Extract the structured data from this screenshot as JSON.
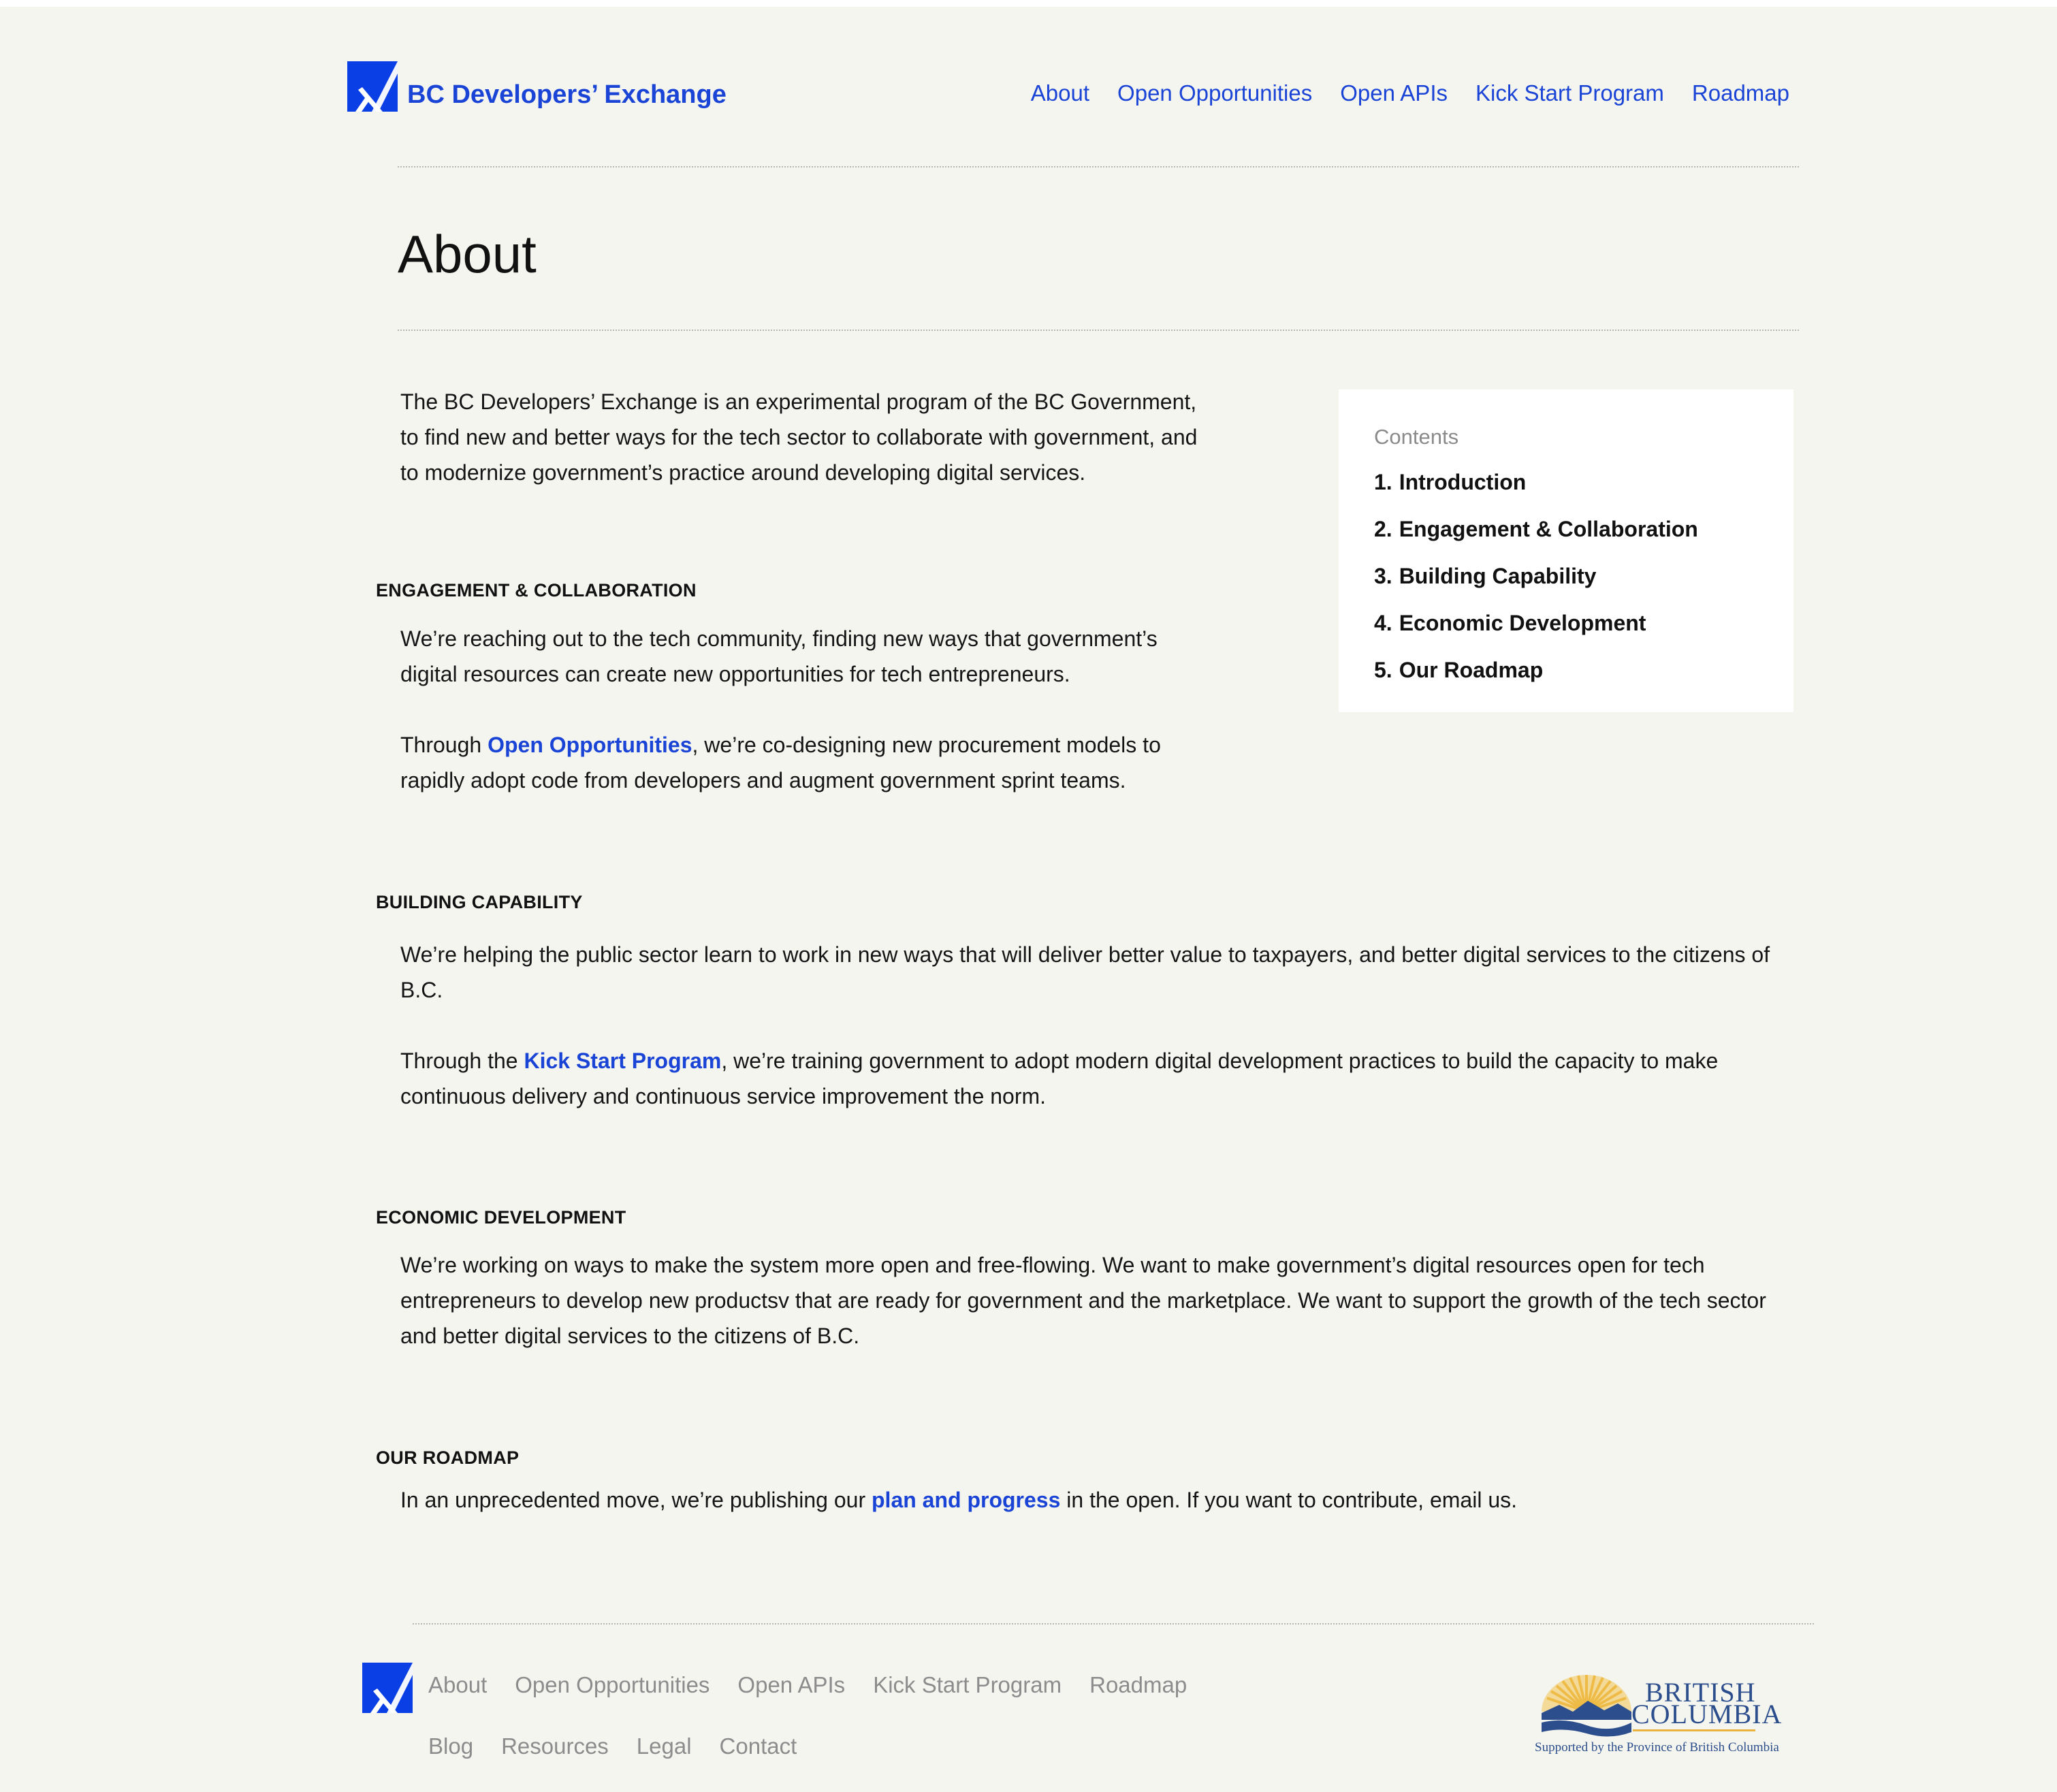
{
  "header": {
    "brand": "BC Developers’ Exchange",
    "nav": [
      "About",
      "Open Opportunities",
      "Open APIs",
      "Kick Start Program",
      "Roadmap"
    ]
  },
  "page_title": "About",
  "intro": "The BC Developers’ Exchange is an experimental program of the BC Government, to find new and better ways for the tech sector to collaborate with government, and to modernize government’s practice around developing digital services.",
  "sections": {
    "engagement": {
      "heading": "ENGAGEMENT & COLLABORATION",
      "p1": "We’re reaching out to the tech community, finding new ways that government’s digital resources can create new opportunities for tech entrepreneurs.",
      "p2_before": "Through ",
      "p2_link": "Open Opportunities",
      "p2_after": ", we’re co-designing new procurement models to rapidly adopt code from developers and augment government sprint teams."
    },
    "capability": {
      "heading": "BUILDING CAPABILITY",
      "p1": "We’re helping the public sector learn to work in new ways that will deliver better value to taxpayers, and better digital services to the citizens of B.C.",
      "p2_before": "Through the ",
      "p2_link": "Kick Start Program",
      "p2_after": ", we’re training government to adopt modern digital development practices to build the capacity to make continuous delivery and continuous service improvement the norm."
    },
    "economic": {
      "heading": "ECONOMIC DEVELOPMENT",
      "p1": "We’re working on ways to make the system more open and  free-flowing.  We want to make government’s digital resources open for tech entrepreneurs to develop new productsv that are ready for government and the marketplace. We want to support the growth of the tech sector and better digital services to the citizens of B.C."
    },
    "roadmap": {
      "heading": "OUR ROADMAP",
      "p1_before": "In an unprecedented move, we’re publishing our ",
      "p1_link": "plan and progress",
      "p1_after": " in the open. If you want to contribute, email us."
    }
  },
  "toc": {
    "title": "Contents",
    "items": [
      {
        "num": "1.",
        "label": "Introduction"
      },
      {
        "num": "2.",
        "label": "Engagement & Collaboration"
      },
      {
        "num": "3.",
        "label": "Building Capability"
      },
      {
        "num": "4.",
        "label": "Economic Development"
      },
      {
        "num": "5.",
        "label": "Our Roadmap"
      }
    ]
  },
  "footer": {
    "nav_row1": [
      "About",
      "Open Opportunities",
      "Open APIs",
      "Kick Start Program",
      "Roadmap"
    ],
    "nav_row2": [
      "Blog",
      "Resources",
      "Legal",
      "Contact"
    ],
    "bc_logo": {
      "line1": "BRITISH",
      "line2": "COLUMBIA",
      "tagline": "Supported by the Province of British Columbia"
    }
  },
  "colors": {
    "accent": "#1a44d6",
    "logo_blue": "#0b3fe6",
    "page_bg": "#f5f5f0",
    "footer_text": "#8c8c8c",
    "bc_gold": "#e8b23c",
    "bc_navy": "#2c4e8c"
  },
  "icons": [
    "devex-x-logo-icon",
    "bc-government-logo"
  ]
}
